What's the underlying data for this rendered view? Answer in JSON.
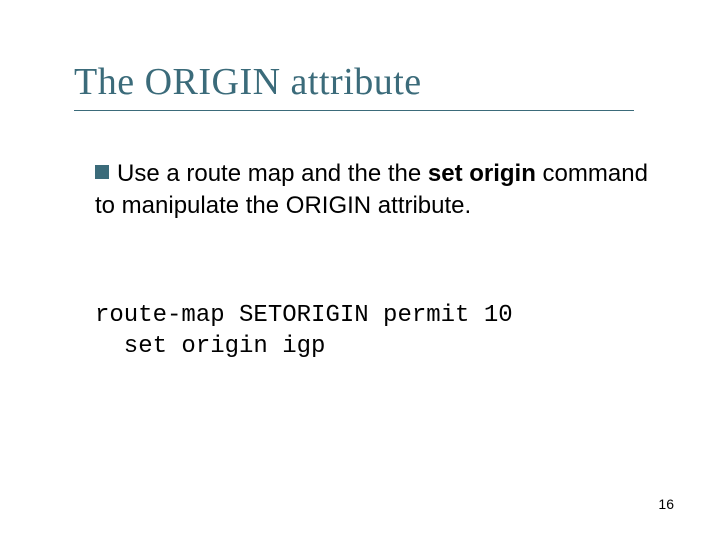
{
  "slide": {
    "title": "The ORIGIN attribute",
    "bullet": {
      "pre": "Use a route map and the the ",
      "strong": "set origin",
      "post": " command to manipulate the ORIGIN attribute."
    },
    "code_line1": "route-map SETORIGIN permit 10",
    "code_line2": "  set origin igp",
    "page_number": "16"
  },
  "colors": {
    "accent": "#3b6b7a"
  }
}
